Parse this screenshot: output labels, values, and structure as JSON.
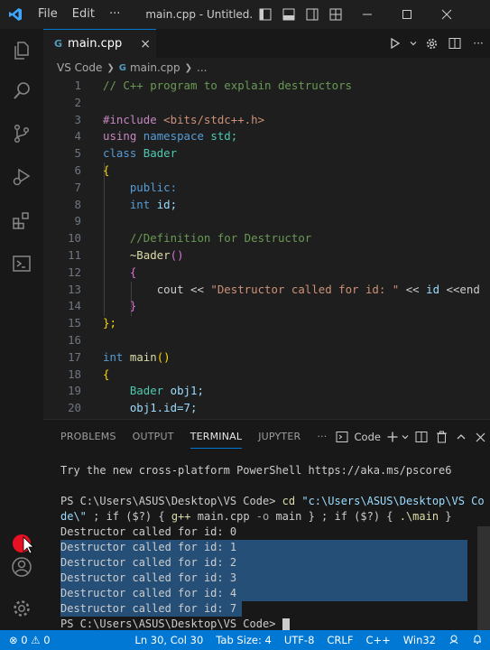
{
  "titlebar": {
    "menu": [
      "File",
      "Edit",
      "···"
    ],
    "title": "main.cpp - Untitled..."
  },
  "tab": {
    "label": "main.cpp",
    "close": "×"
  },
  "breadcrumb": {
    "root": "VS Code",
    "file": "main.cpp",
    "more": "..."
  },
  "code_lines": [
    {
      "n": "1"
    },
    {
      "n": "2"
    },
    {
      "n": "3"
    },
    {
      "n": "4"
    },
    {
      "n": "5"
    },
    {
      "n": "6"
    },
    {
      "n": "7"
    },
    {
      "n": "8"
    },
    {
      "n": "9"
    },
    {
      "n": "10"
    },
    {
      "n": "11"
    },
    {
      "n": "12"
    },
    {
      "n": "13"
    },
    {
      "n": "14"
    },
    {
      "n": "15"
    },
    {
      "n": "16"
    },
    {
      "n": "17"
    },
    {
      "n": "18"
    },
    {
      "n": "19"
    },
    {
      "n": "20"
    }
  ],
  "code": {
    "l1": "// C++ program to explain destructors",
    "l3_pp": "#include",
    "l3_inc": "<bits/stdc++.h>",
    "l4_using": "using",
    "l4_ns": "namespace",
    "l4_std": "std;",
    "l5_class": "class",
    "l5_name": "Bader",
    "l6": "{",
    "l7": "public:",
    "l8_type": "int",
    "l8_var": "id;",
    "l10": "//Definition for Destructor",
    "l11": "~Bader",
    "l11_paren": "()",
    "l12": "{",
    "l13_cout": "cout <<",
    "l13_str": "\"Destructor called for id: \"",
    "l13_op": "<<",
    "l13_id": "id",
    "l13_end": "<<end",
    "l14": "}",
    "l15": "};",
    "l17_type": "int",
    "l17_fn": "main",
    "l17_paren": "()",
    "l18": "{",
    "l19_type": "Bader",
    "l19_var": "obj1;",
    "l20": "obj1.id=7;"
  },
  "panel": {
    "tabs": [
      "PROBLEMS",
      "OUTPUT",
      "TERMINAL",
      "JUPYTER"
    ],
    "active_tab": "TERMINAL",
    "more": "···",
    "shell": "Code"
  },
  "terminal": {
    "line1": "Try the new cross-platform PowerShell https://aka.ms/pscore6",
    "prompt1": "PS C:\\Users\\ASUS\\Desktop\\VS Code>",
    "cmd_cd": "cd",
    "cmd_path_a": "\"c:\\Users\\ASUS\\Desktop\\VS Co",
    "cmd_path_b": "de\\\"",
    "cmd_rest_a": " ; if ($?) { ",
    "cmd_gpp": "g++",
    "cmd_rest_b": " main.cpp ",
    "cmd_o": "-o",
    "cmd_rest_c": " main } ; if ($?) { ",
    "cmd_run": ".\\main",
    "cmd_rest_d": " }",
    "outputs": [
      "Destructor called for id: 0",
      "Destructor called for id: 1",
      "Destructor called for id: 2",
      "Destructor called for id: 3",
      "Destructor called for id: 4",
      "Destructor called for id: 7"
    ],
    "prompt2": "PS C:\\Users\\ASUS\\Desktop\\VS Code>"
  },
  "statusbar": {
    "errors": "0",
    "warnings": "0",
    "position": "Ln 30, Col 30",
    "tab_size": "Tab Size: 4",
    "encoding": "UTF-8",
    "eol": "CRLF",
    "language": "C++",
    "platform": "Win32"
  },
  "colors": {
    "accent": "#0078d4",
    "selection": "#264f78",
    "editor_bg": "#1e1e1e"
  }
}
